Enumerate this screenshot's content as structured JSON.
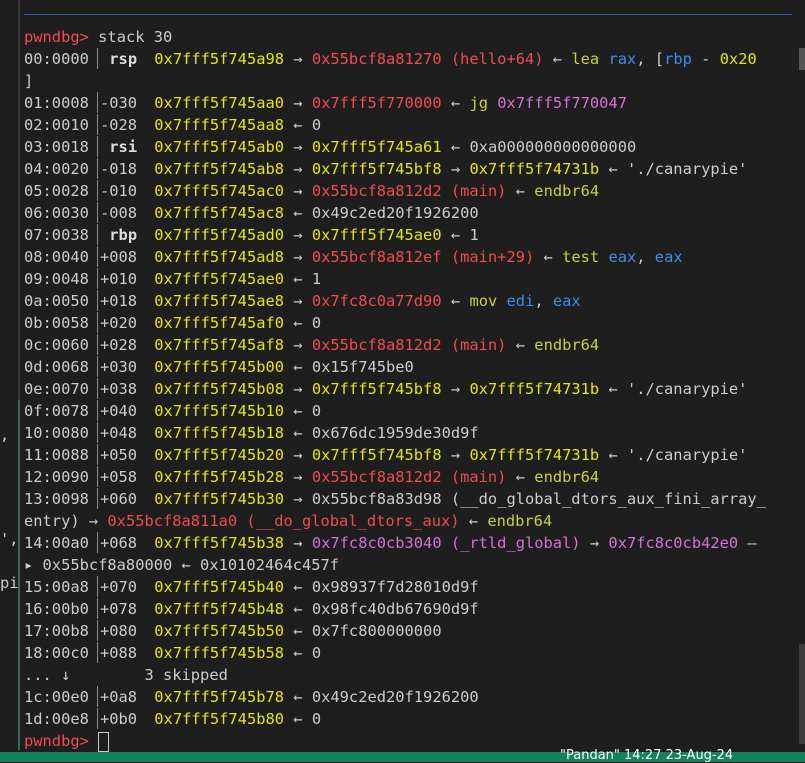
{
  "prompt": "pwndbg>",
  "command": "stack 30",
  "lines": [
    {
      "addr": "00:0000",
      "off": "",
      "reg": "rsp",
      "ptr": "0x7fff5f745a98",
      "arrow": "→",
      "val": "0x55bcf8a81270 (hello+64)",
      "arrow2": "←",
      "tail": "lea rax, [rbp - 0x20"
    },
    {
      "cont": "]"
    },
    {
      "addr": "01:0008",
      "off": "-030",
      "ptr": "0x7fff5f745aa0",
      "arrow": "→",
      "val": "0x7fff5f770000",
      "arrow2": "←",
      "tail": "jg 0x7fff5f770047"
    },
    {
      "addr": "02:0010",
      "off": "-028",
      "ptr": "0x7fff5f745aa8",
      "arrow": "←",
      "val": "0"
    },
    {
      "addr": "03:0018",
      "off": "",
      "reg": "rsi",
      "ptr": "0x7fff5f745ab0",
      "arrow": "→",
      "val": "0x7fff5f745a61",
      "arrow2": "←",
      "tail": "0xa000000000000000"
    },
    {
      "addr": "04:0020",
      "off": "-018",
      "ptr": "0x7fff5f745ab8",
      "arrow": "→",
      "val": "0x7fff5f745bf8",
      "arrow2": "→",
      "tail": "0x7fff5f74731b ← './canarypie'"
    },
    {
      "addr": "05:0028",
      "off": "-010",
      "ptr": "0x7fff5f745ac0",
      "arrow": "→",
      "val": "0x55bcf8a812d2 (main)",
      "arrow2": "←",
      "tail": "endbr64"
    },
    {
      "addr": "06:0030",
      "off": "-008",
      "ptr": "0x7fff5f745ac8",
      "arrow": "←",
      "val": "0x49c2ed20f1926200"
    },
    {
      "addr": "07:0038",
      "off": "",
      "reg": "rbp",
      "ptr": "0x7fff5f745ad0",
      "arrow": "→",
      "val": "0x7fff5f745ae0",
      "arrow2": "←",
      "tail": "1"
    },
    {
      "addr": "08:0040",
      "off": "+008",
      "ptr": "0x7fff5f745ad8",
      "arrow": "→",
      "val": "0x55bcf8a812ef (main+29)",
      "arrow2": "←",
      "tail": "test eax, eax"
    },
    {
      "addr": "09:0048",
      "off": "+010",
      "ptr": "0x7fff5f745ae0",
      "arrow": "←",
      "val": "1"
    },
    {
      "addr": "0a:0050",
      "off": "+018",
      "ptr": "0x7fff5f745ae8",
      "arrow": "→",
      "val": "0x7fc8c0a77d90",
      "arrow2": "←",
      "tail": "mov edi, eax"
    },
    {
      "addr": "0b:0058",
      "off": "+020",
      "ptr": "0x7fff5f745af0",
      "arrow": "←",
      "val": "0"
    },
    {
      "addr": "0c:0060",
      "off": "+028",
      "ptr": "0x7fff5f745af8",
      "arrow": "→",
      "val": "0x55bcf8a812d2 (main)",
      "arrow2": "←",
      "tail": "endbr64"
    },
    {
      "addr": "0d:0068",
      "off": "+030",
      "ptr": "0x7fff5f745b00",
      "arrow": "←",
      "val": "0x15f745be0"
    },
    {
      "addr": "0e:0070",
      "off": "+038",
      "ptr": "0x7fff5f745b08",
      "arrow": "→",
      "val": "0x7fff5f745bf8",
      "arrow2": "→",
      "tail": "0x7fff5f74731b ← './canarypie'"
    },
    {
      "addr": "0f:0078",
      "off": "+040",
      "ptr": "0x7fff5f745b10",
      "arrow": "←",
      "val": "0"
    },
    {
      "addr": "10:0080",
      "off": "+048",
      "ptr": "0x7fff5f745b18",
      "arrow": "←",
      "val": "0x676dc1959de30d9f"
    },
    {
      "addr": "11:0088",
      "off": "+050",
      "ptr": "0x7fff5f745b20",
      "arrow": "→",
      "val": "0x7fff5f745bf8",
      "arrow2": "→",
      "tail": "0x7fff5f74731b ← './canarypie'"
    },
    {
      "addr": "12:0090",
      "off": "+058",
      "ptr": "0x7fff5f745b28",
      "arrow": "→",
      "val": "0x55bcf8a812d2 (main)",
      "arrow2": "←",
      "tail": "endbr64"
    },
    {
      "addr": "13:0098",
      "off": "+060",
      "ptr": "0x7fff5f745b30",
      "arrow": "→",
      "val": "0x55bcf8a83d98 (__do_global_dtors_aux_fini_array_"
    },
    {
      "cont": "entry) → 0x55bcf8a811a0 (__do_global_dtors_aux) ← endbr64"
    },
    {
      "addr": "14:00a0",
      "off": "+068",
      "ptr": "0x7fff5f745b38",
      "arrow": "→",
      "val": "0x7fc8c0cb3040 (_rtld_global)",
      "arrow2": "→",
      "tail": "0x7fc8c0cb42e0 —"
    },
    {
      "cont": "▸ 0x55bcf8a80000 ← 0x10102464c457f"
    },
    {
      "addr": "15:00a8",
      "off": "+070",
      "ptr": "0x7fff5f745b40",
      "arrow": "←",
      "val": "0x98937f7d28010d9f"
    },
    {
      "addr": "16:00b0",
      "off": "+078",
      "ptr": "0x7fff5f745b48",
      "arrow": "←",
      "val": "0x98fc40db67690d9f"
    },
    {
      "addr": "17:00b8",
      "off": "+080",
      "ptr": "0x7fff5f745b50",
      "arrow": "←",
      "val": "0x7fc800000000"
    },
    {
      "addr": "18:00c0",
      "off": "+088",
      "ptr": "0x7fff5f745b58",
      "arrow": "←",
      "val": "0"
    },
    {
      "skip": "... ↓        3 skipped"
    },
    {
      "addr": "1c:00e0",
      "off": "+0a8",
      "ptr": "0x7fff5f745b78",
      "arrow": "←",
      "val": "0x49c2ed20f1926200"
    },
    {
      "addr": "1d:00e8",
      "off": "+0b0",
      "ptr": "0x7fff5f745b80",
      "arrow": "←",
      "val": "0"
    }
  ],
  "left_fragments": [
    ",",
    "',",
    "pi"
  ],
  "status_text": "\"Pandan\" 14:27 23-Aug-24"
}
